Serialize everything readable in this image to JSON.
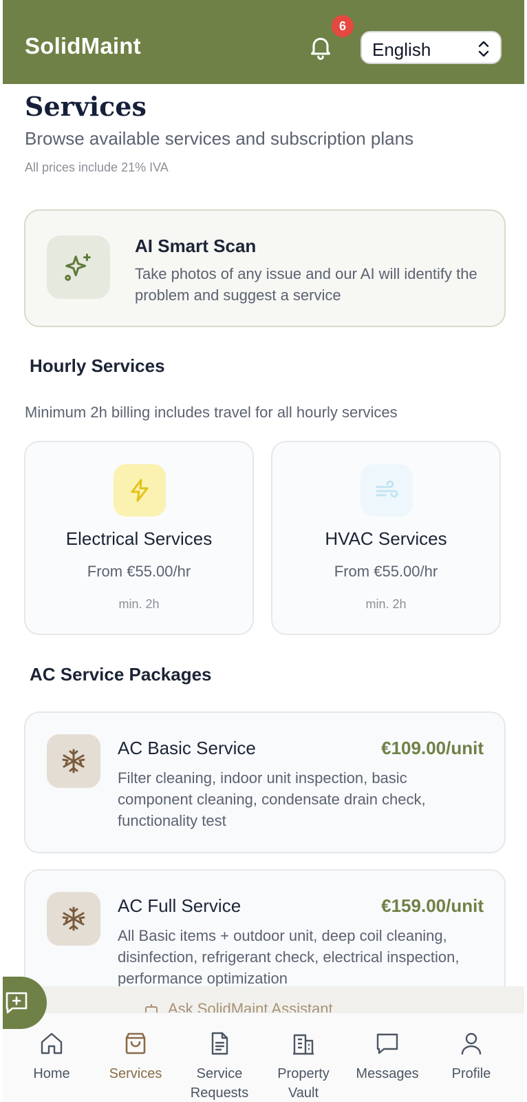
{
  "header": {
    "brand": "SolidMaint",
    "notification_count": "6",
    "language": "English"
  },
  "page": {
    "title": "Services",
    "subtitle": "Browse available services and subscription plans",
    "price_note": "All prices include 21% IVA"
  },
  "ai_scan": {
    "title": "AI Smart Scan",
    "description": "Take photos of any issue and our AI will identify the problem and suggest a service"
  },
  "hourly": {
    "title": "Hourly Services",
    "note": "Minimum 2h billing includes travel for all hourly services",
    "cards": [
      {
        "title": "Electrical Services",
        "price": "From €55.00/hr",
        "min": "min. 2h",
        "icon": "lightning-icon"
      },
      {
        "title": "HVAC Services",
        "price": "From €55.00/hr",
        "min": "min. 2h",
        "icon": "wind-icon"
      }
    ]
  },
  "packages": {
    "title": "AC Service Packages",
    "items": [
      {
        "title": "AC Basic Service",
        "price": "€109.00/unit",
        "description": "Filter cleaning, indoor unit inspection, basic component cleaning, condensate drain check, functionality test",
        "icon": "snowflake-icon"
      },
      {
        "title": "AC Full Service",
        "price": "€159.00/unit",
        "description": "All Basic items + outdoor unit, deep coil cleaning, disinfection, refrigerant check, electrical inspection, performance optimization",
        "icon": "snowflake-icon"
      }
    ]
  },
  "assistant": {
    "label": "Ask SolidMaint Assistant"
  },
  "nav": {
    "items": [
      {
        "label": "Home",
        "icon": "home-icon"
      },
      {
        "label": "Services",
        "icon": "shopping-bag-icon",
        "active": true
      },
      {
        "label": "Service Requests",
        "icon": "document-icon"
      },
      {
        "label": "Property Vault",
        "icon": "building-icon"
      },
      {
        "label": "Messages",
        "icon": "chat-icon"
      },
      {
        "label": "Profile",
        "icon": "user-icon"
      }
    ]
  },
  "colors": {
    "brand": "#6f8146",
    "accent_brown": "#8a6b48",
    "badge": "#e5483e"
  }
}
